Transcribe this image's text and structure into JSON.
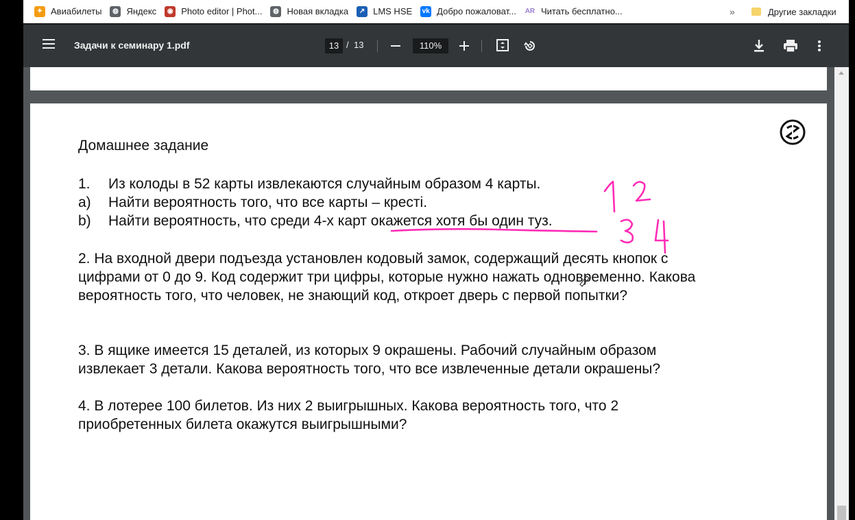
{
  "bookmarks": {
    "items": [
      {
        "label": "Авиабилеты",
        "icon": "flame-icon"
      },
      {
        "label": "Яндекс",
        "icon": "globe-icon"
      },
      {
        "label": "Photo editor | Phot...",
        "icon": "photo-editor-icon"
      },
      {
        "label": "Новая вкладка",
        "icon": "globe-icon"
      },
      {
        "label": "LMS HSE",
        "icon": "lms-icon"
      },
      {
        "label": "Добро пожаловат...",
        "icon": "vk-icon"
      },
      {
        "label": "Читать бесплатно...",
        "icon": "ar-icon"
      }
    ],
    "overflow": "»",
    "other": "Другие закладки"
  },
  "toolbar": {
    "title": "Задачи к семинару 1.pdf",
    "page_current": "13",
    "page_sep": "/",
    "page_total": "13",
    "zoom": "110%"
  },
  "document": {
    "heading": "Домашнее задание",
    "problem1": {
      "num": "1.",
      "text": "Из колоды в 52 карты извлекаются случайным образом 4 карты.",
      "a_label": "a)",
      "a_text": "Найти вероятность того, что все карты – кресті.",
      "b_label": "b)",
      "b_text": "Найти вероятность, что среди 4-х карт окажется хотя бы один туз."
    },
    "problem2": "2. На входной двери подъезда установлен кодовый замок, содержащий десять кнопок с цифрами от 0 до 9. Код содержит три цифры, которые нужно нажать одновременно. Какова вероятность того, что человек, не знающий код, откроет дверь с первой попытки?",
    "problem3": "3. В ящике имеется 15 деталей, из которых 9 окрашены. Рабочий случайным образом извлекает 3 детали. Какова вероятность того, что все извлеченные детали окрашены?",
    "problem4": "4. В лотерее 100 билетов. Из них 2 выигрышных. Какова вероятность того, что 2 приобретенных билета окажутся выигрышными?"
  },
  "annotations": {
    "color": "#ff2bb6",
    "digits": [
      "1",
      "2",
      "3",
      "4"
    ]
  }
}
